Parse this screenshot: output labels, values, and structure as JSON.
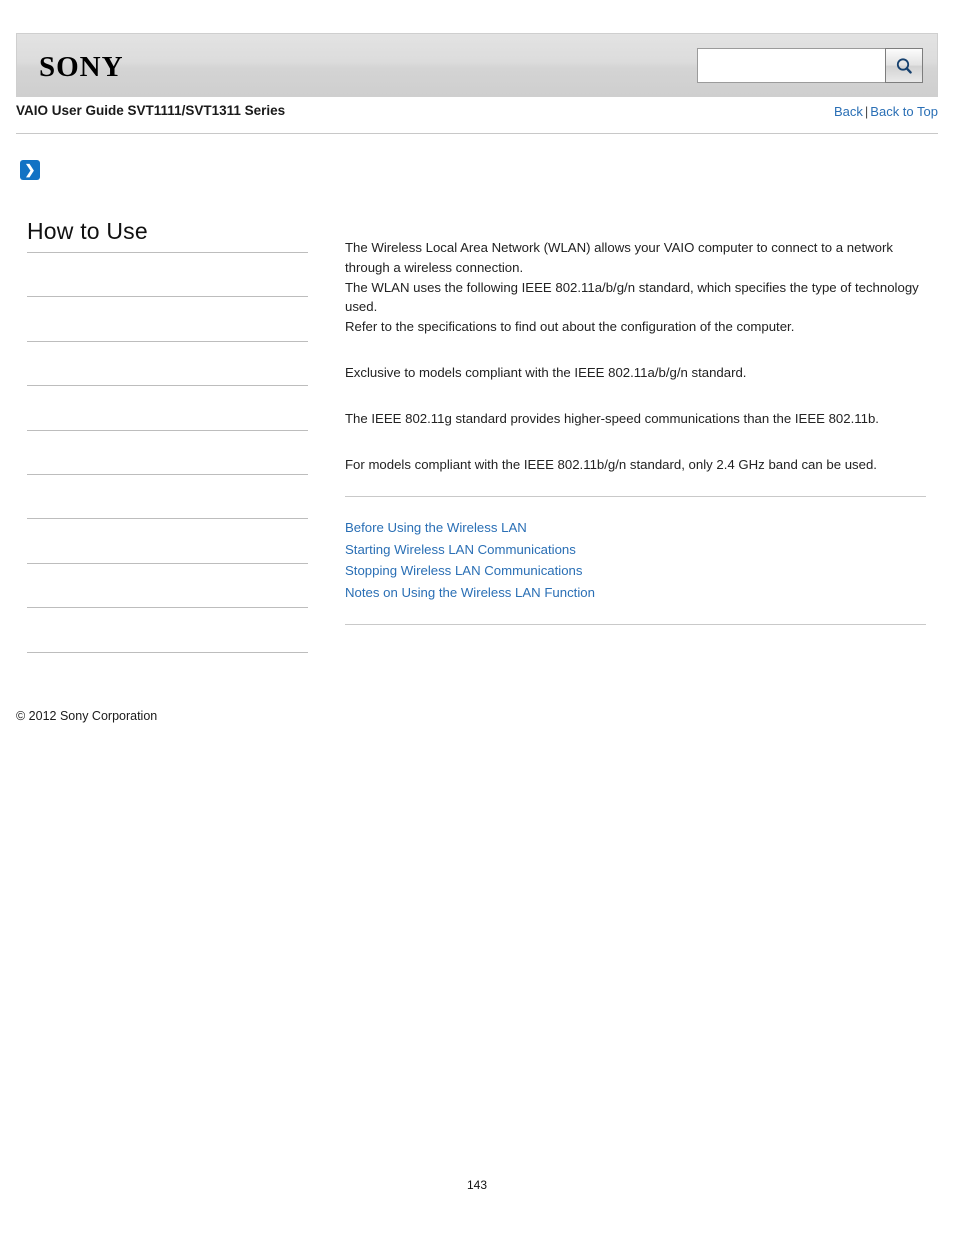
{
  "header": {
    "logo_text": "SONY",
    "search": {
      "value": "",
      "placeholder": "",
      "icon": "search-icon"
    }
  },
  "titlebar": {
    "guide_title": "VAIO User Guide SVT1111/SVT1311 Series",
    "back_label": "Back",
    "separator": "|",
    "back_to_top_label": "Back to Top"
  },
  "breadcrumb": {
    "arrow_glyph": "❯"
  },
  "sidebar": {
    "heading": "How to Use",
    "items": [
      {
        "label": ""
      },
      {
        "label": ""
      },
      {
        "label": ""
      },
      {
        "label": ""
      },
      {
        "label": ""
      },
      {
        "label": ""
      },
      {
        "label": ""
      },
      {
        "label": ""
      },
      {
        "label": ""
      }
    ]
  },
  "main": {
    "paragraphs": [
      "The Wireless Local Area Network (WLAN) allows your VAIO computer to connect to a network through a wireless connection.\nThe WLAN uses the following IEEE 802.11a/b/g/n standard, which specifies the type of technology used.\nRefer to the specifications to find out about the configuration of the computer.",
      "Exclusive to models compliant with the IEEE 802.11a/b/g/n standard.",
      "The IEEE 802.11g standard provides higher-speed communications than the IEEE 802.11b.",
      "For models compliant with the IEEE 802.11b/g/n standard, only 2.4 GHz band can be used."
    ],
    "related_links": [
      "Before Using the Wireless LAN",
      "Starting Wireless LAN Communications",
      "Stopping Wireless LAN Communications",
      "Notes on Using the Wireless LAN Function"
    ]
  },
  "footer": {
    "copyright": "© 2012 Sony Corporation",
    "page_number": "143"
  },
  "colors": {
    "link": "#2a6fb5",
    "accent": "#1272c4",
    "header_bg": "#dcdcdc"
  }
}
